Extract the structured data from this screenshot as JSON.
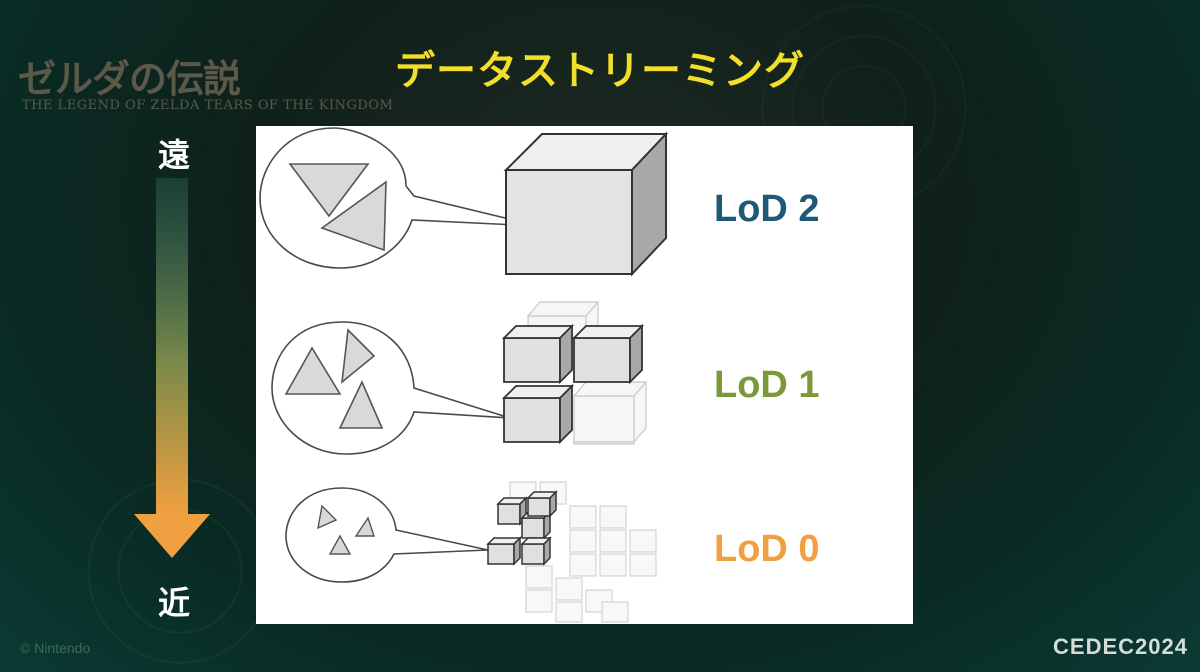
{
  "slide": {
    "title": "データストリーミング",
    "logo_jp": "ゼルダの伝説",
    "logo_en": "THE LEGEND OF ZELDA TEARS OF THE KINGDOM",
    "far_label": "遠",
    "near_label": "近",
    "copyright": "© Nintendo",
    "event_logo": "CEDEC2024"
  },
  "colors": {
    "title": "#f2df2a",
    "lod2": "#1e5a78",
    "lod1": "#7a9a3a",
    "lod0": "#f0a040",
    "arrow_top": "#2d6a5c",
    "arrow_bottom": "#f0a040"
  },
  "lod_levels": [
    {
      "label": "LoD 2",
      "color": "#1e5a78"
    },
    {
      "label": "LoD 1",
      "color": "#7a9a3a"
    },
    {
      "label": "LoD 0",
      "color": "#f0a040"
    }
  ]
}
